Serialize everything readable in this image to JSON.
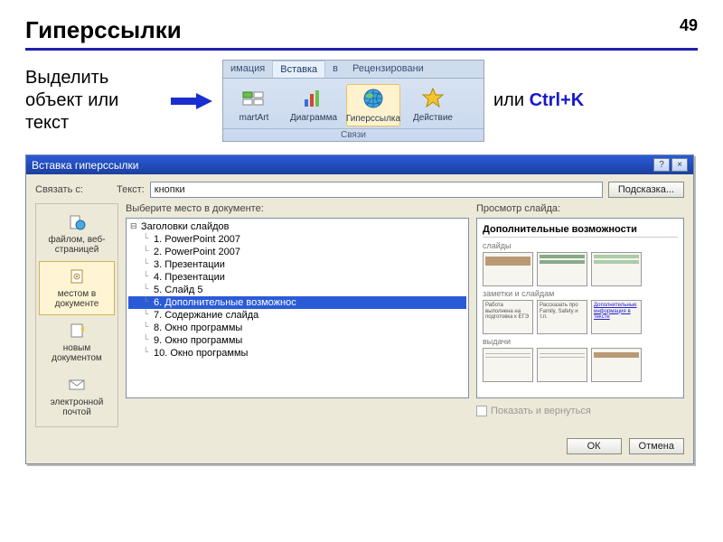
{
  "page_number": "49",
  "title": "Гиперссылки",
  "instruction": "Выделить объект или текст",
  "or_text": "или ",
  "shortcut": "Ctrl+K",
  "ribbon": {
    "tabs": [
      "имация",
      "Вставка",
      "в",
      "Рецензировани"
    ],
    "selected_tab": "Вставка",
    "buttons": {
      "smartart": "martArt",
      "chart": "Диаграмма",
      "hyperlink": "Гиперссылка",
      "action": "Действие"
    },
    "group": "Связи"
  },
  "dialog": {
    "title": "Вставка гиперссылки",
    "link_with": "Связать с:",
    "text_label": "Текст:",
    "text_value": "кнопки",
    "hint_btn": "Подсказка...",
    "linkbar": {
      "file": "файлом, веб-страницей",
      "indoc": "местом в документе",
      "newdoc": "новым документом",
      "email": "электронной почтой"
    },
    "select_place_label": "Выберите место в документе:",
    "tree_root": "Заголовки слайдов",
    "tree_items": [
      "1. PowerPoint 2007",
      "2. PowerPoint 2007",
      "3. Презентации",
      "4. Презентации",
      "5. Слайд 5",
      "6. Дополнительные возможнос",
      "7. Содержание слайда",
      "8. Окно программы",
      "9. Окно программы",
      "10. Окно программы"
    ],
    "tree_selected_index": 5,
    "preview_label": "Просмотр слайда:",
    "preview_title": "Дополнительные возможности",
    "pv_section1": "слайды",
    "pv_section2": "заметки и слайдам",
    "pv_section3": "выдачи",
    "thumb_texts": [
      "Работа выполнена на подготовка к ЕГЭ",
      "Рассказать про Family, Safety и т.п.",
      "Дополнительные информация в тексте"
    ],
    "show_return": "Показать и вернуться",
    "ok": "ОК",
    "cancel": "Отмена"
  }
}
